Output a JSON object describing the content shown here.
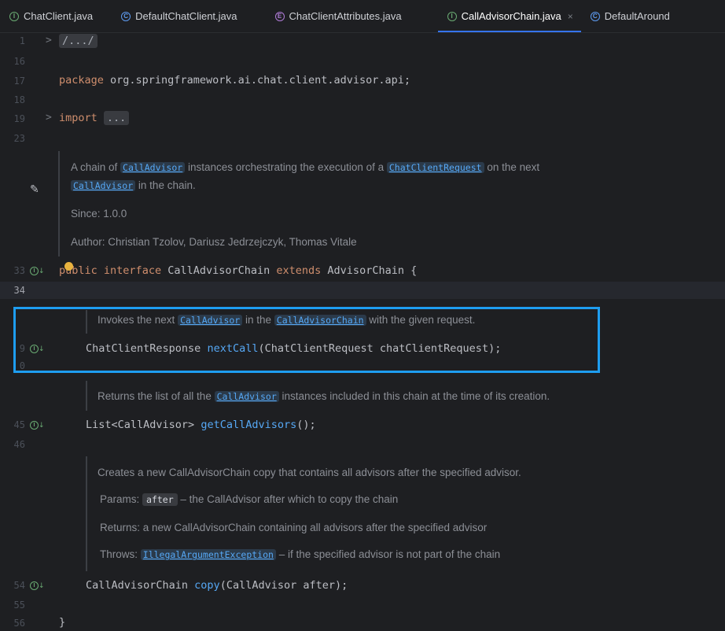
{
  "tabs": [
    {
      "label": "ChatClient.java",
      "icon": "interface-icon",
      "glyph": "I"
    },
    {
      "label": "DefaultChatClient.java",
      "icon": "class-icon",
      "glyph": "C"
    },
    {
      "label": "ChatClientAttributes.java",
      "icon": "enum-icon",
      "glyph": "E"
    },
    {
      "label": "CallAdvisorChain.java",
      "icon": "interface-icon",
      "glyph": "I",
      "close": "×"
    },
    {
      "label": "DefaultAround",
      "icon": "class-icon",
      "glyph": "C"
    }
  ],
  "lines": {
    "n1": "1",
    "n16": "16",
    "n17": "17",
    "n18": "18",
    "n19": "19",
    "n23": "23",
    "n33": "33",
    "n34": "34",
    "n39": "9",
    "n40": "0",
    "n45": "45",
    "n46": "46",
    "n54": "54",
    "n55": "55",
    "n56": "56"
  },
  "code": {
    "header_fold": "/.../",
    "package_kw": "package",
    "package_name": " org.springframework.ai.chat.client.advisor.api;",
    "import_kw": "import",
    "import_fold": "...",
    "iface_public": "public",
    "iface_interface": "interface",
    "iface_name": " CallAdvisorChain ",
    "iface_extends": "extends",
    "iface_parent": " AdvisorChain {",
    "m1_ret": "ChatClientResponse ",
    "m1_name": "nextCall",
    "m1_params": "(ChatClientRequest chatClientRequest);",
    "m2_ret": "List<CallAdvisor> ",
    "m2_name": "getCallAdvisors",
    "m2_params": "();",
    "m3_ret": "CallAdvisorChain ",
    "m3_name": "copy",
    "m3_params": "(CallAdvisor after);",
    "close_brace": "}"
  },
  "docs": {
    "class_doc_a": "A chain of ",
    "class_doc_ref1": "CallAdvisor",
    "class_doc_b": " instances orchestrating the execution of a ",
    "class_doc_ref2": "ChatClientRequest",
    "class_doc_c": " on the next",
    "class_doc_ref3": "CallAdvisor",
    "class_doc_d": " in the chain.",
    "since": "Since:   1.0.0",
    "author": "Author: Christian Tzolov, Dariusz Jedrzejczyk, Thomas Vitale",
    "next_a": "Invokes the next ",
    "next_ref1": "CallAdvisor",
    "next_b": " in the ",
    "next_ref2": "CallAdvisorChain",
    "next_c": " with the given request.",
    "list_a": "Returns the list of all the ",
    "list_ref": "CallAdvisor",
    "list_b": " instances included in this chain at the time of its creation.",
    "copy_desc": "Creates a new CallAdvisorChain copy that contains all advisors after the specified advisor.",
    "params_label": "Params: ",
    "params_pill": "after",
    "params_text": " – the CallAdvisor after which to copy the chain",
    "returns": "Returns: a new CallAdvisorChain containing all advisors after the specified advisor",
    "throws_label": "Throws: ",
    "throws_ref": "IllegalArgumentException",
    "throws_text": " – if the specified advisor is not part of the chain"
  },
  "colors": {
    "highlight_border": "#1e9df0",
    "keyword": "#cf8e6d",
    "method": "#56a8f5",
    "tab_underline": "#3574f0"
  }
}
